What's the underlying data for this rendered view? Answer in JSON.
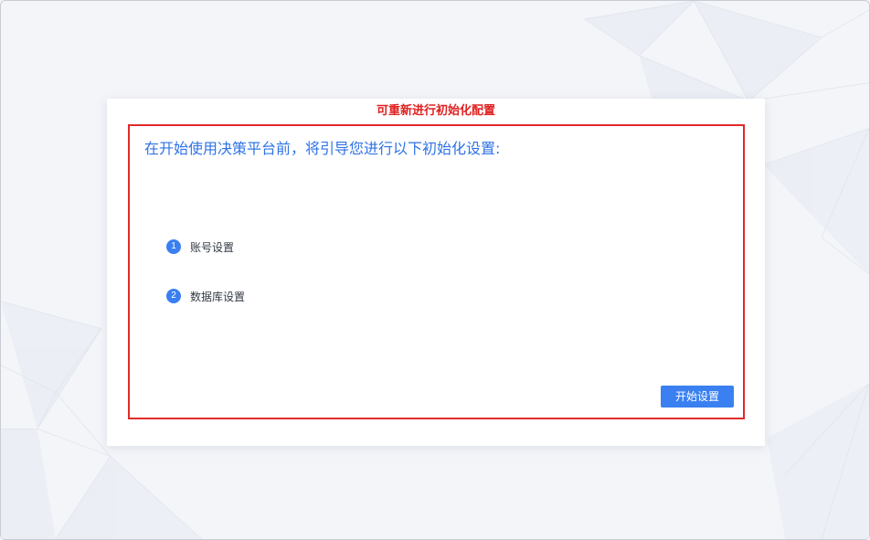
{
  "annotation": {
    "note": "可重新进行初始化配置"
  },
  "wizard": {
    "title": "在开始使用决策平台前，将引导您进行以下初始化设置:",
    "steps": [
      {
        "number": "1",
        "label": "账号设置"
      },
      {
        "number": "2",
        "label": "数据库设置"
      }
    ],
    "start_button_label": "开始设置"
  },
  "colors": {
    "accent": "#3a80f0",
    "title": "#2f73e6",
    "annotation": "#e02020",
    "background": "#f3f5f9"
  }
}
